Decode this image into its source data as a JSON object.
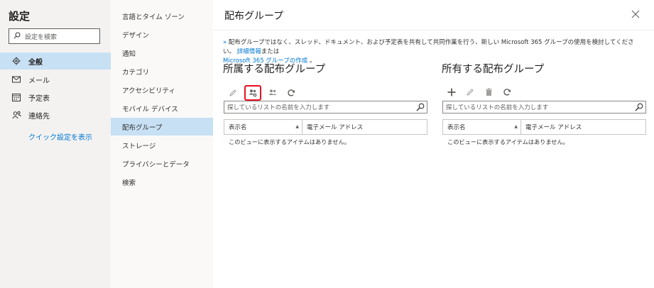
{
  "settings": {
    "title": "設定",
    "search_placeholder": "設定を検索"
  },
  "leftnav": {
    "items": [
      {
        "label": "全般",
        "icon": "gear-icon",
        "active": true
      },
      {
        "label": "メール",
        "icon": "mail-icon",
        "active": false
      },
      {
        "label": "予定表",
        "icon": "calendar-icon",
        "active": false
      },
      {
        "label": "連絡先",
        "icon": "people-icon",
        "active": false
      }
    ],
    "quick_settings": "クイック設定を表示"
  },
  "subnav": {
    "items": [
      {
        "label": "言語とタイム ゾーン",
        "active": false
      },
      {
        "label": "デザイン",
        "active": false
      },
      {
        "label": "通知",
        "active": false
      },
      {
        "label": "カテゴリ",
        "active": false
      },
      {
        "label": "アクセシビリティ",
        "active": false
      },
      {
        "label": "モバイル デバイス",
        "active": false
      },
      {
        "label": "配布グループ",
        "active": true
      },
      {
        "label": "ストレージ",
        "active": false
      },
      {
        "label": "プライバシーとデータ",
        "active": false
      },
      {
        "label": "検索",
        "active": false
      }
    ]
  },
  "main": {
    "title": "配布グループ",
    "info_text": "配布グループではなく、スレッド、ドキュメント、および予定表を共有して共同作業を行う、新しい Microsoft 365 グループの使用を検討してください。",
    "info_link1": "詳細情報",
    "info_mid": "または",
    "info_link2": "Microsoft 365 グループの作成",
    "info_end": "。"
  },
  "member_panel": {
    "title": "所属する配布グループ",
    "search_placeholder": "探しているリストの名前を入力します",
    "col_display_name": "表示名",
    "col_email": "電子メール アドレス",
    "empty": "このビューに表示するアイテムはありません。"
  },
  "owner_panel": {
    "title": "所有する配布グループ",
    "search_placeholder": "探しているリストの名前を入力します",
    "col_display_name": "表示名",
    "col_email": "電子メール アドレス",
    "empty": "このビューに表示するアイテムはありません。"
  },
  "colors": {
    "accent": "#0078d4",
    "selected_bg": "#c7e0f4",
    "highlight": "#e81123"
  }
}
